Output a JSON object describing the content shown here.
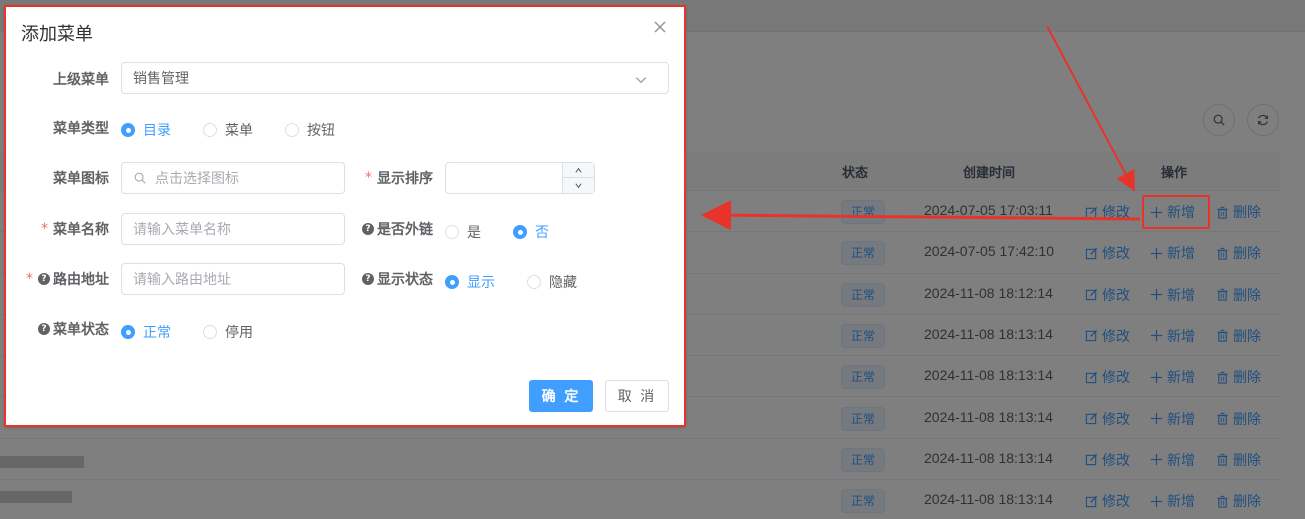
{
  "dialog": {
    "title": "添加菜单",
    "fields": {
      "parent_menu": {
        "label": "上级菜单",
        "value": "销售管理"
      },
      "menu_type": {
        "label": "菜单类型",
        "options": [
          "目录",
          "菜单",
          "按钮"
        ],
        "selected": "目录"
      },
      "menu_icon": {
        "label": "菜单图标",
        "placeholder": "点击选择图标"
      },
      "display_order": {
        "label": "显示排序"
      },
      "menu_name": {
        "label": "菜单名称",
        "placeholder": "请输入菜单名称"
      },
      "external_link": {
        "label": "是否外链",
        "options": [
          "是",
          "否"
        ],
        "selected": "否"
      },
      "route_path": {
        "label": "路由地址",
        "placeholder": "请输入路由地址"
      },
      "display_status": {
        "label": "显示状态",
        "options": [
          "显示",
          "隐藏"
        ],
        "selected": "显示"
      },
      "menu_status": {
        "label": "菜单状态",
        "options": [
          "正常",
          "停用"
        ],
        "selected": "正常"
      }
    },
    "buttons": {
      "confirm": "确 定",
      "cancel": "取 消"
    }
  },
  "table": {
    "headers": {
      "status": "状态",
      "created": "创建时间",
      "actions": "操作"
    },
    "actions": {
      "edit": "修改",
      "add": "新增",
      "delete": "删除"
    },
    "rows": [
      {
        "status": "正常",
        "created": "2024-07-05 17:03:11"
      },
      {
        "status": "正常",
        "created": "2024-07-05 17:42:10"
      },
      {
        "status": "正常",
        "created": "2024-11-08 18:12:14"
      },
      {
        "status": "正常",
        "created": "2024-11-08 18:13:14"
      },
      {
        "status": "正常",
        "created": "2024-11-08 18:13:14"
      },
      {
        "status": "正常",
        "created": "2024-11-08 18:13:14"
      },
      {
        "status": "正常",
        "created": "2024-11-08 18:13:14"
      },
      {
        "status": "正常",
        "created": "2024-11-08 18:13:14"
      }
    ]
  },
  "colors": {
    "primary": "#409eff",
    "annotation": "#e8332a",
    "required": "#f56c6c"
  }
}
